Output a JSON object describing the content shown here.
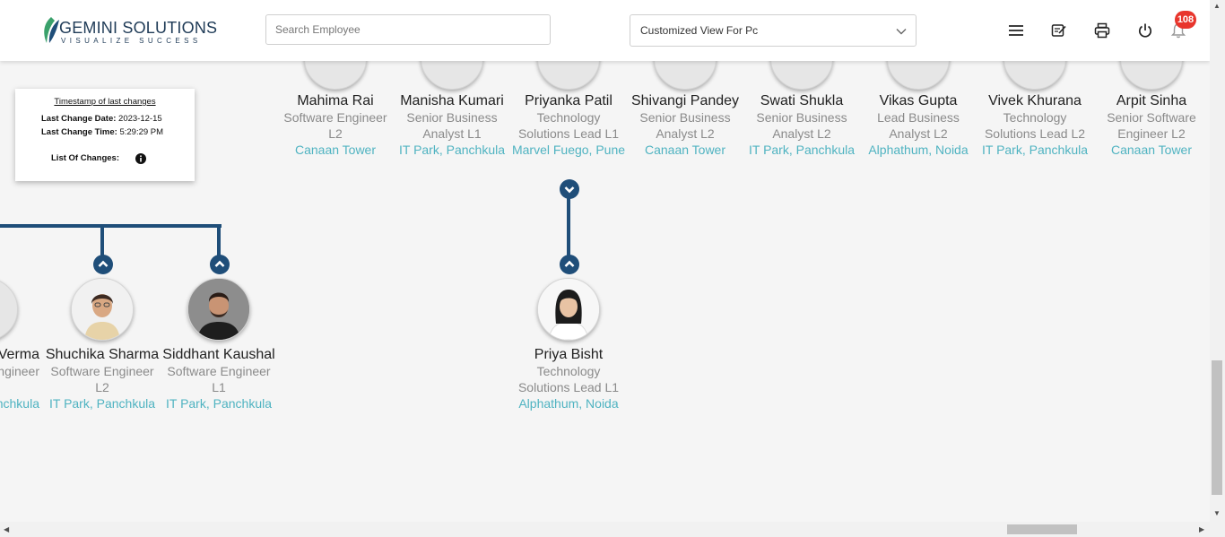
{
  "header": {
    "logo_name": "GEMINI SOLUTIONS",
    "logo_tagline": "VISUALIZE SUCCESS",
    "search_placeholder": "Search Employee",
    "view_select_value": "Customized View For Pc",
    "notification_count": "108",
    "icons": [
      "menu-icon",
      "edit-note-icon",
      "print-icon",
      "power-icon",
      "bell-icon"
    ]
  },
  "changes_panel": {
    "title": "Timestamp of last changes",
    "date_label": "Last Change Date:",
    "date_value": "2023-12-15",
    "time_label": "Last Change Time:",
    "time_value": "5:29:29 PM",
    "list_label": "List Of Changes:"
  },
  "top_row": [
    {
      "name": "Mahima Rai",
      "designation": "Software Engineer L2",
      "location": "Canaan Tower"
    },
    {
      "name": "Manisha Kumari",
      "designation": "Senior Business Analyst L1",
      "location": "IT Park, Panchkula"
    },
    {
      "name": "Priyanka Patil",
      "designation": "Technology Solutions Lead L1",
      "location": "Marvel Fuego, Pune"
    },
    {
      "name": "Shivangi Pandey",
      "designation": "Senior Business Analyst L2",
      "location": "Canaan Tower"
    },
    {
      "name": "Swati Shukla",
      "designation": "Senior Business Analyst L2",
      "location": "IT Park, Panchkula"
    },
    {
      "name": "Vikas Gupta",
      "designation": "Lead Business Analyst L2",
      "location": "Alphathum, Noida"
    },
    {
      "name": "Vivek Khurana",
      "designation": "Technology Solutions Lead L2",
      "location": "IT Park, Panchkula"
    },
    {
      "name": "Arpit Sinha",
      "designation": "Senior Software Engineer L2",
      "location": "Canaan Tower"
    }
  ],
  "bottom_row": [
    {
      "name": "Verma",
      "designation": "ngineer",
      "location": "nchkula"
    },
    {
      "name": "Shuchika Sharma",
      "designation": "Software Engineer L2",
      "location": "IT Park, Panchkula"
    },
    {
      "name": "Siddhant Kaushal",
      "designation": "Software Engineer L1",
      "location": "IT Park, Panchkula"
    },
    {
      "name": "Priya Bisht",
      "designation": "Technology Solutions Lead L1",
      "location": "Alphathum, Noida"
    }
  ],
  "colors": {
    "accent": "#1f4e79",
    "location_text": "#4fb3c1",
    "badge": "#e8352c",
    "logo_leaf": "#3aa16b"
  }
}
